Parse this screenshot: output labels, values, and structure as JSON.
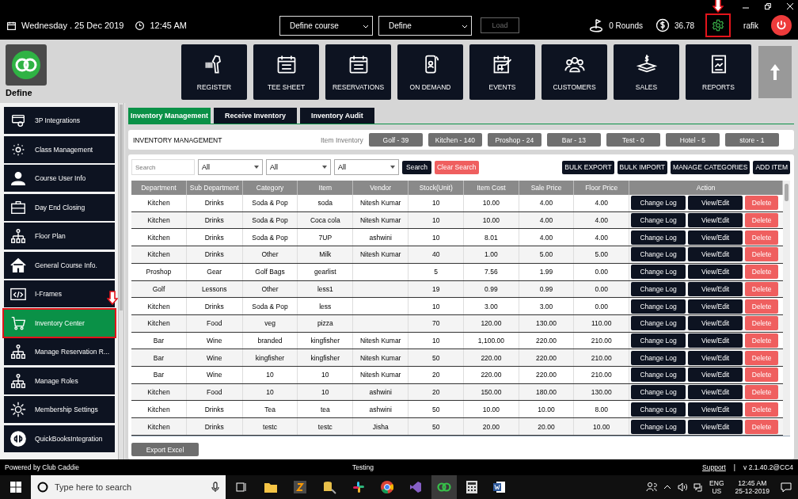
{
  "top_bar": {
    "date": "Wednesday .  25 Dec 2019",
    "time": "12:45 AM",
    "course_select": "Define  course",
    "site_select": "Define",
    "load_button": {
      "label": "Load",
      "disabled": true
    },
    "rounds": "0 Rounds",
    "balance": "36.78",
    "settings": {
      "marked": true
    },
    "user": "rafik"
  },
  "brand": {
    "name": "Define"
  },
  "nav": [
    {
      "label": "REGISTER"
    },
    {
      "label": "TEE SHEET"
    },
    {
      "label": "RESERVATIONS"
    },
    {
      "label": "ON DEMAND"
    },
    {
      "label": "EVENTS"
    },
    {
      "label": "CUSTOMERS"
    },
    {
      "label": "SALES"
    },
    {
      "label": "REPORTS"
    }
  ],
  "sidebar": {
    "items": [
      {
        "label": "3P Integrations",
        "selected": false,
        "marked": false
      },
      {
        "label": "Class Management",
        "selected": false,
        "marked": false
      },
      {
        "label": "Course User Info",
        "selected": false,
        "marked": false
      },
      {
        "label": "Day End Closing",
        "selected": false,
        "marked": false
      },
      {
        "label": "Floor Plan",
        "selected": false,
        "marked": false
      },
      {
        "label": "General Course Info.",
        "selected": false,
        "marked": false
      },
      {
        "label": "I-Frames",
        "selected": false,
        "marked": false
      },
      {
        "label": "Inventory Center",
        "selected": true,
        "marked": true
      },
      {
        "label": "Manage Reservation R...",
        "selected": false,
        "marked": false
      },
      {
        "label": "Manage Roles",
        "selected": false,
        "marked": false
      },
      {
        "label": "Membership Settings",
        "selected": false,
        "marked": false
      },
      {
        "label": "QuickBooksIntegration",
        "selected": false,
        "marked": false
      }
    ]
  },
  "tabs": [
    {
      "label": "Inventory Management",
      "selected": true
    },
    {
      "label": "Receive Inventory",
      "selected": false
    },
    {
      "label": "Inventory Audit",
      "selected": false
    }
  ],
  "inventory_summary": {
    "title": "INVENTORY MANAGEMENT",
    "label": "Item Inventory",
    "counts": [
      "Golf - 39",
      "Kitchen - 140",
      "Proshop - 24",
      "Bar - 13",
      "Test - 0",
      "Hotel - 5",
      "store - 1"
    ]
  },
  "filters": {
    "search_placeholder": "Search",
    "selects": [
      "All",
      "All",
      "All"
    ],
    "search_button": "Search",
    "clear_button": "Clear Search",
    "actions": [
      "BULK EXPORT",
      "BULK IMPORT",
      "MANAGE CATEGORIES",
      "ADD ITEM"
    ]
  },
  "table": {
    "columns": [
      "Department",
      "Sub Department",
      "Category",
      "Item",
      "Vendor",
      "Stock(Unit)",
      "Item Cost",
      "Sale Price",
      "Floor Price",
      "Action"
    ],
    "rows": [
      {
        "department": "Kitchen",
        "sub_department": "Drinks",
        "category": "Soda & Pop",
        "item": "soda",
        "vendor": "Nitesh Kumar",
        "stock": "10",
        "item_cost": "10.00",
        "sale_price": "4.00",
        "floor_price": "4.00",
        "actions": [
          "Change Log",
          "View/Edit",
          "Delete"
        ]
      },
      {
        "department": "Kitchen",
        "sub_department": "Drinks",
        "category": "Soda & Pop",
        "item": "Coca cola",
        "vendor": "Nitesh Kumar",
        "stock": "10",
        "item_cost": "10.00",
        "sale_price": "4.00",
        "floor_price": "4.00",
        "actions": [
          "Change Log",
          "View/Edit",
          "Delete"
        ]
      },
      {
        "department": "Kitchen",
        "sub_department": "Drinks",
        "category": "Soda & Pop",
        "item": "7UP",
        "vendor": "ashwini",
        "stock": "10",
        "item_cost": "8.01",
        "sale_price": "4.00",
        "floor_price": "4.00",
        "actions": [
          "Change Log",
          "View/Edit",
          "Delete"
        ]
      },
      {
        "department": "Kitchen",
        "sub_department": "Drinks",
        "category": "Other",
        "item": "Milk",
        "vendor": "Nitesh Kumar",
        "stock": "40",
        "item_cost": "1.00",
        "sale_price": "5.00",
        "floor_price": "5.00",
        "actions": [
          "Change Log",
          "View/Edit",
          "Delete"
        ]
      },
      {
        "department": "Proshop",
        "sub_department": "Gear",
        "category": "Golf Bags",
        "item": "gearlist",
        "stock": "5",
        "item_cost": "7.56",
        "sale_price": "1.99",
        "floor_price": "0.00",
        "actions": [
          "Change Log",
          "View/Edit",
          "Delete"
        ]
      },
      {
        "department": "Golf",
        "sub_department": "Lessons",
        "category": "Other",
        "item": "less1",
        "stock": "19",
        "item_cost": "0.99",
        "sale_price": "0.99",
        "floor_price": "0.00",
        "actions": [
          "Change Log",
          "View/Edit",
          "Delete"
        ]
      },
      {
        "department": "Kitchen",
        "sub_department": "Drinks",
        "category": "Soda & Pop",
        "item": "less",
        "stock": "10",
        "item_cost": "3.00",
        "sale_price": "3.00",
        "floor_price": "0.00",
        "actions": [
          "Change Log",
          "View/Edit",
          "Delete"
        ]
      },
      {
        "department": "Kitchen",
        "sub_department": "Food",
        "category": "veg",
        "item": "pizza",
        "stock": "70",
        "item_cost": "120.00",
        "sale_price": "130.00",
        "floor_price": "110.00",
        "actions": [
          "Change Log",
          "View/Edit",
          "Delete"
        ]
      },
      {
        "department": "Bar",
        "sub_department": "Wine",
        "category": "branded",
        "item": "kingfisher",
        "vendor": "Nitesh Kumar",
        "stock": "10",
        "item_cost": "1,100.00",
        "sale_price": "220.00",
        "floor_price": "210.00",
        "actions": [
          "Change Log",
          "View/Edit",
          "Delete"
        ]
      },
      {
        "department": "Bar",
        "sub_department": "Wine",
        "category": "kingfisher",
        "item": "kingfisher",
        "vendor": "Nitesh Kumar",
        "stock": "50",
        "item_cost": "220.00",
        "sale_price": "220.00",
        "floor_price": "210.00",
        "actions": [
          "Change Log",
          "View/Edit",
          "Delete"
        ]
      },
      {
        "department": "Bar",
        "sub_department": "Wine",
        "category": "10",
        "item": "10",
        "vendor": "Nitesh Kumar",
        "stock": "20",
        "item_cost": "220.00",
        "sale_price": "220.00",
        "floor_price": "210.00",
        "actions": [
          "Change Log",
          "View/Edit",
          "Delete"
        ]
      },
      {
        "department": "Kitchen",
        "sub_department": "Food",
        "category": "10",
        "item": "10",
        "vendor": "ashwini",
        "stock": "20",
        "item_cost": "150.00",
        "sale_price": "180.00",
        "floor_price": "130.00",
        "actions": [
          "Change Log",
          "View/Edit",
          "Delete"
        ]
      },
      {
        "department": "Kitchen",
        "sub_department": "Drinks",
        "category": "Tea",
        "item": "tea",
        "vendor": "ashwini",
        "stock": "50",
        "item_cost": "10.00",
        "sale_price": "10.00",
        "floor_price": "8.00",
        "actions": [
          "Change Log",
          "View/Edit",
          "Delete"
        ]
      },
      {
        "department": "Kitchen",
        "sub_department": "Drinks",
        "category": "testc",
        "item": "testc",
        "vendor": "Jisha",
        "stock": "50",
        "item_cost": "20.00",
        "sale_price": "20.00",
        "floor_price": "10.00",
        "actions": [
          "Change Log",
          "View/Edit",
          "Delete"
        ]
      }
    ]
  },
  "export_button": "Export Excel",
  "footer": {
    "powered_by": "Powered by Club Caddie",
    "environment": "Testing",
    "support_link": "Support",
    "separator": "|",
    "version": "v 2.1.40.2@CC4"
  },
  "taskbar": {
    "search_placeholder": "Type here to search",
    "language": "ENG",
    "region": "US",
    "time": "12:45 AM",
    "date": "25-12-2019"
  }
}
